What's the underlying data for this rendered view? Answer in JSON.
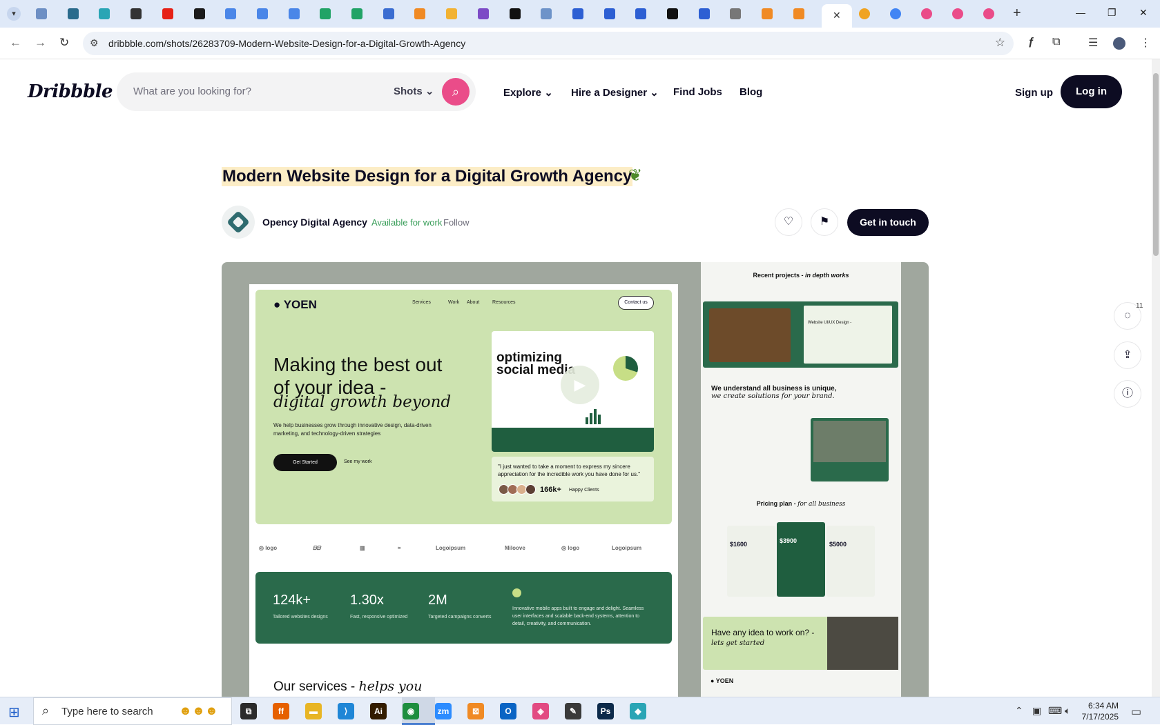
{
  "browser": {
    "url": "dribbble.com/shots/26283709-Modern-Website-Design-for-a-Digital-Growth-Agency",
    "tab_close": "✕",
    "new_tab": "+",
    "controls": {
      "minimize": "—",
      "restore": "❐",
      "close": "✕"
    },
    "tab_icons": [
      {
        "name": "tab-icon-1",
        "color": "#6d8fc4"
      },
      {
        "name": "tab-icon-2",
        "color": "#2a6b8c"
      },
      {
        "name": "tab-icon-3",
        "color": "#2aa5b5"
      },
      {
        "name": "tab-icon-4",
        "color": "#333333"
      },
      {
        "name": "tab-icon-youtube",
        "color": "#e62117"
      },
      {
        "name": "tab-icon-6",
        "color": "#1b1b1b"
      },
      {
        "name": "tab-icon-docs",
        "color": "#4a86e8"
      },
      {
        "name": "tab-icon-docs",
        "color": "#4a86e8"
      },
      {
        "name": "tab-icon-docs",
        "color": "#4a86e8"
      },
      {
        "name": "tab-icon-sheets",
        "color": "#21a366"
      },
      {
        "name": "tab-icon-sheets",
        "color": "#21a366"
      },
      {
        "name": "tab-icon-12",
        "color": "#3b6dd1"
      },
      {
        "name": "tab-icon-13",
        "color": "#f08a24"
      },
      {
        "name": "tab-icon-14",
        "color": "#f2b233"
      },
      {
        "name": "tab-icon-15",
        "color": "#7c4bc6"
      },
      {
        "name": "tab-icon-16",
        "color": "#111111"
      },
      {
        "name": "tab-icon-17",
        "color": "#6d93c9"
      },
      {
        "name": "tab-icon-18",
        "color": "#2d5fd3"
      },
      {
        "name": "tab-icon-19",
        "color": "#2d5fd3"
      },
      {
        "name": "tab-icon-20",
        "color": "#2d5fd3"
      },
      {
        "name": "tab-icon-21",
        "color": "#111111"
      },
      {
        "name": "tab-icon-22",
        "color": "#2d5fd3"
      },
      {
        "name": "tab-icon-23",
        "color": "#777777"
      },
      {
        "name": "tab-icon-24",
        "color": "#f08a24"
      },
      {
        "name": "tab-icon-25",
        "color": "#f08a24"
      }
    ],
    "right_tab_icons": [
      {
        "name": "tab-icon-26",
        "color": "#f0a321"
      },
      {
        "name": "tab-icon-google",
        "color": "#4285f4"
      },
      {
        "name": "tab-icon-dribbble",
        "color": "#ea4c89"
      },
      {
        "name": "tab-icon-dribbble",
        "color": "#ea4c89"
      },
      {
        "name": "tab-icon-dribbble",
        "color": "#ea4c89"
      }
    ]
  },
  "site": {
    "logo": "Dribbble",
    "search_placeholder": "What are you looking for?",
    "search_scope": "Shots",
    "nav": [
      "Explore",
      "Hire a Designer",
      "Find Jobs",
      "Blog"
    ],
    "sign_up": "Sign up",
    "log_in": "Log in"
  },
  "shot": {
    "title": "Modern Website Design for a Digital Growth Agency",
    "author": "Opency Digital Agency",
    "availability": "Available for work",
    "follow": "Follow",
    "cta": "Get in touch",
    "comment_count": "11"
  },
  "mockup": {
    "logo": "YOEN",
    "nav": [
      "Services",
      "Work",
      "About",
      "Resources"
    ],
    "contact": "Contact us",
    "headline": "Making the best out of your idea -",
    "headline_italic": "digital growth beyond",
    "sub": "We help businesses grow through innovative design, data-driven marketing, and technology-driven strategies",
    "get_started": "Get Started",
    "see_work": "See my work",
    "video_title": "optimizing social media",
    "quote": "\"I just wanted to take a moment to express my sincere appreciation for the incredible work you have done for us.\"",
    "clients_count": "166k+",
    "clients_label": "Happy Clients",
    "brands": [
      "Logoipsum",
      "Miloove",
      "Logoipsum"
    ],
    "stats": [
      {
        "value": "124k+",
        "label": "Tailored websites designs"
      },
      {
        "value": "1.30x",
        "label": "Fast, responsive optimized"
      },
      {
        "value": "2M",
        "label": "Targeted campaigns converts"
      }
    ],
    "stats_desc": "Innovative mobile apps built to engage and delight. Seamless user interfaces and scalable back-end systems, attention to detail, creativity, and communication.",
    "services": "Our services -",
    "services_italic": "helps you",
    "recent": "Recent projects -",
    "recent_italic": "in depth works",
    "project_card": "Website UI/UX Design -",
    "unique": "We understand all business is unique,",
    "unique_italic": "we create solutions for your brand.",
    "pricing": "Pricing plan -",
    "pricing_italic": "for all business",
    "prices": [
      "$1600",
      "$3900",
      "$5000"
    ],
    "idea": "Have any idea to work on? -",
    "idea_italic": "lets get started",
    "footer_logo": "YOEN"
  },
  "taskbar": {
    "search_placeholder": "Type here to search",
    "time": "6:34 AM",
    "date": "7/17/2025",
    "apps": [
      {
        "name": "taskview-icon",
        "label": "⧉",
        "color": "#2b2b2b"
      },
      {
        "name": "firefox-icon",
        "label": "ff",
        "color": "#e66000"
      },
      {
        "name": "file-explorer-icon",
        "label": "▬",
        "color": "#e8b525"
      },
      {
        "name": "vscode-icon",
        "label": "⟩",
        "color": "#1f86d6"
      },
      {
        "name": "illustrator-icon",
        "label": "Ai",
        "color": "#331c00"
      },
      {
        "name": "chrome-icon",
        "label": "◉",
        "color": "#1e8e3e"
      },
      {
        "name": "zoom-icon",
        "label": "zm",
        "color": "#2d8cff"
      },
      {
        "name": "xampp-icon",
        "label": "⊠",
        "color": "#f08a24"
      },
      {
        "name": "outlook-icon",
        "label": "O",
        "color": "#0a64c4"
      },
      {
        "name": "creative-cloud-icon",
        "label": "◈",
        "color": "#e24a82"
      },
      {
        "name": "pen-tool-icon",
        "label": "✎",
        "color": "#3a3a3a"
      },
      {
        "name": "photoshop-icon",
        "label": "Ps",
        "color": "#0c2a4a"
      },
      {
        "name": "app-icon",
        "label": "◆",
        "color": "#2aa5b5"
      }
    ]
  }
}
